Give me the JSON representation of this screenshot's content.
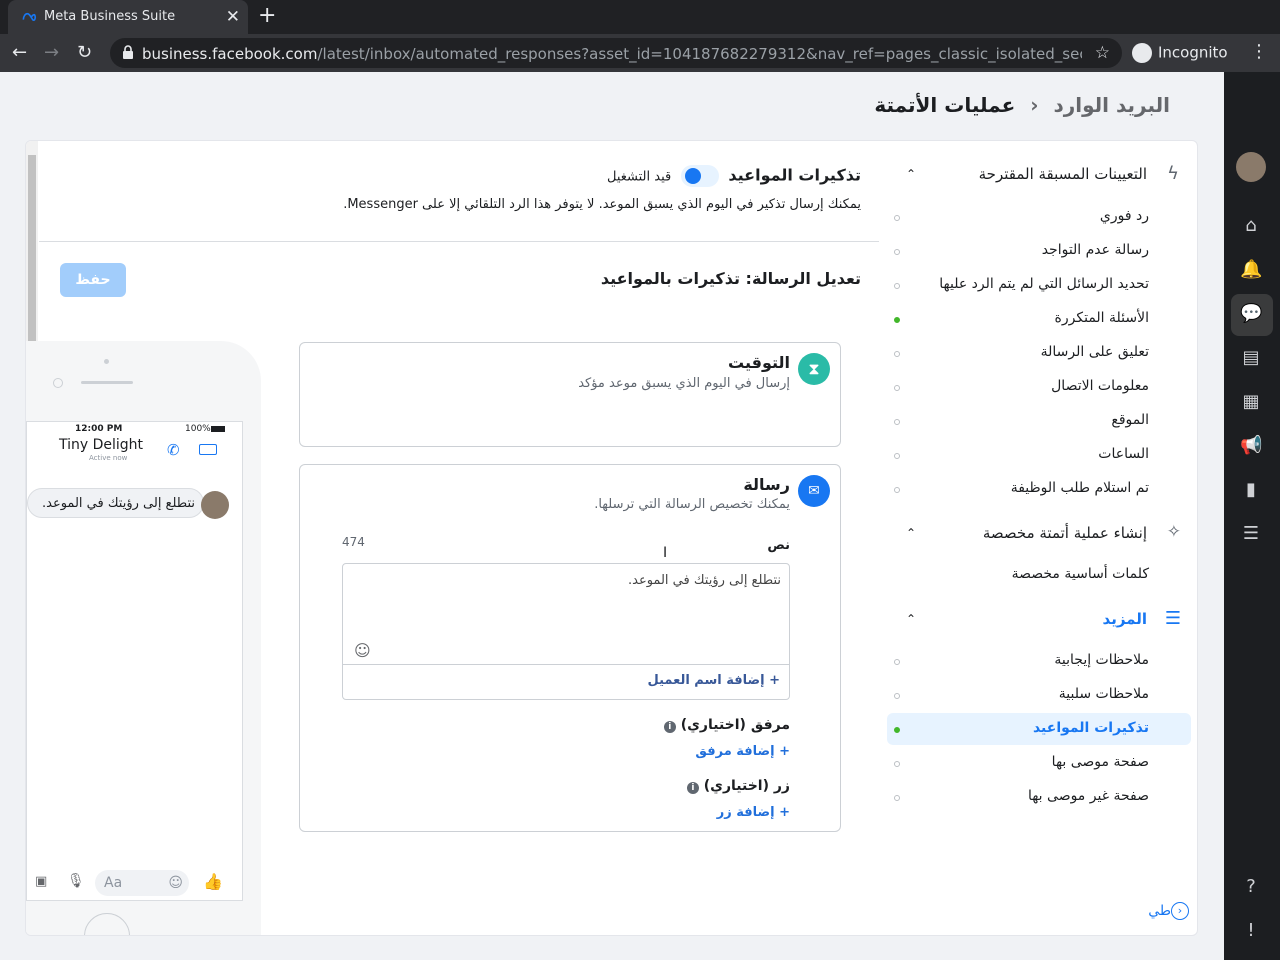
{
  "browser": {
    "tab_title": "Meta Business Suite",
    "url_host": "business.facebook.com",
    "url_path": "/latest/inbox/automated_responses?asset_id=104187682279312&nav_ref=pages_classic_isolated_section_...",
    "incognito_label": "Incognito"
  },
  "header": {
    "breadcrumb_root": "البريد الوارد",
    "breadcrumb_current": "عمليات الأتمتة"
  },
  "sidebar": {
    "suggested_title": "التعيينات المسبقة المقترحة",
    "suggested_items": [
      "رد فوري",
      "رسالة عدم التواجد",
      "تحديد الرسائل التي لم يتم الرد عليها",
      "الأسئلة المتكررة",
      "تعليق على الرسالة",
      "معلومات الاتصال",
      "الموقع",
      "الساعات",
      "تم استلام طلب الوظيفة"
    ],
    "custom_title": "إنشاء عملية أتمتة مخصصة",
    "custom_items": [
      "كلمات أساسية مخصصة"
    ],
    "more_title": "المزيد",
    "more_items": [
      "ملاحظات إيجابية",
      "ملاحظات سلبية",
      "تذكيرات المواعيد",
      "صفحة موصى بها",
      "صفحة غير موصى بها"
    ],
    "collapse_label": "طي"
  },
  "automation": {
    "title": "تذكيرات المواعيد",
    "status": "قيد التشغيل",
    "description": "يمكنك إرسال تذكير في اليوم الذي يسبق الموعد. لا يتوفر هذا الرد التلقائي إلا على Messenger.",
    "edit_title": "تعديل الرسالة: تذكيرات بالمواعيد",
    "save_label": "حفظ"
  },
  "timing": {
    "title": "التوقيت",
    "subtitle": "إرسال في اليوم الذي يسبق موعد مؤكد"
  },
  "message": {
    "title": "رسالة",
    "subtitle": "يمكنك تخصيص الرسالة التي ترسلها.",
    "text_label": "نص",
    "char_count": "474",
    "text_value": "نتطلع إلى رؤيتك في الموعد.",
    "add_customer_name": "+ إضافة اسم العميل",
    "attachment_label": "مرفق (اختياري)",
    "add_attachment": "+ إضافة مرفق",
    "button_label": "زر (اختياري)",
    "add_button": "+ إضافة زر"
  },
  "preview": {
    "time": "12:00 PM",
    "battery": "100%",
    "page_name": "Tiny Delight",
    "active": "Active now",
    "bubble_text": "نتطلع إلى رؤيتك في الموعد.",
    "composer_placeholder": "Aa"
  },
  "colors": {
    "accent": "#1877f2",
    "active_dot": "#42b72a",
    "timing_icon": "#2abba7"
  }
}
